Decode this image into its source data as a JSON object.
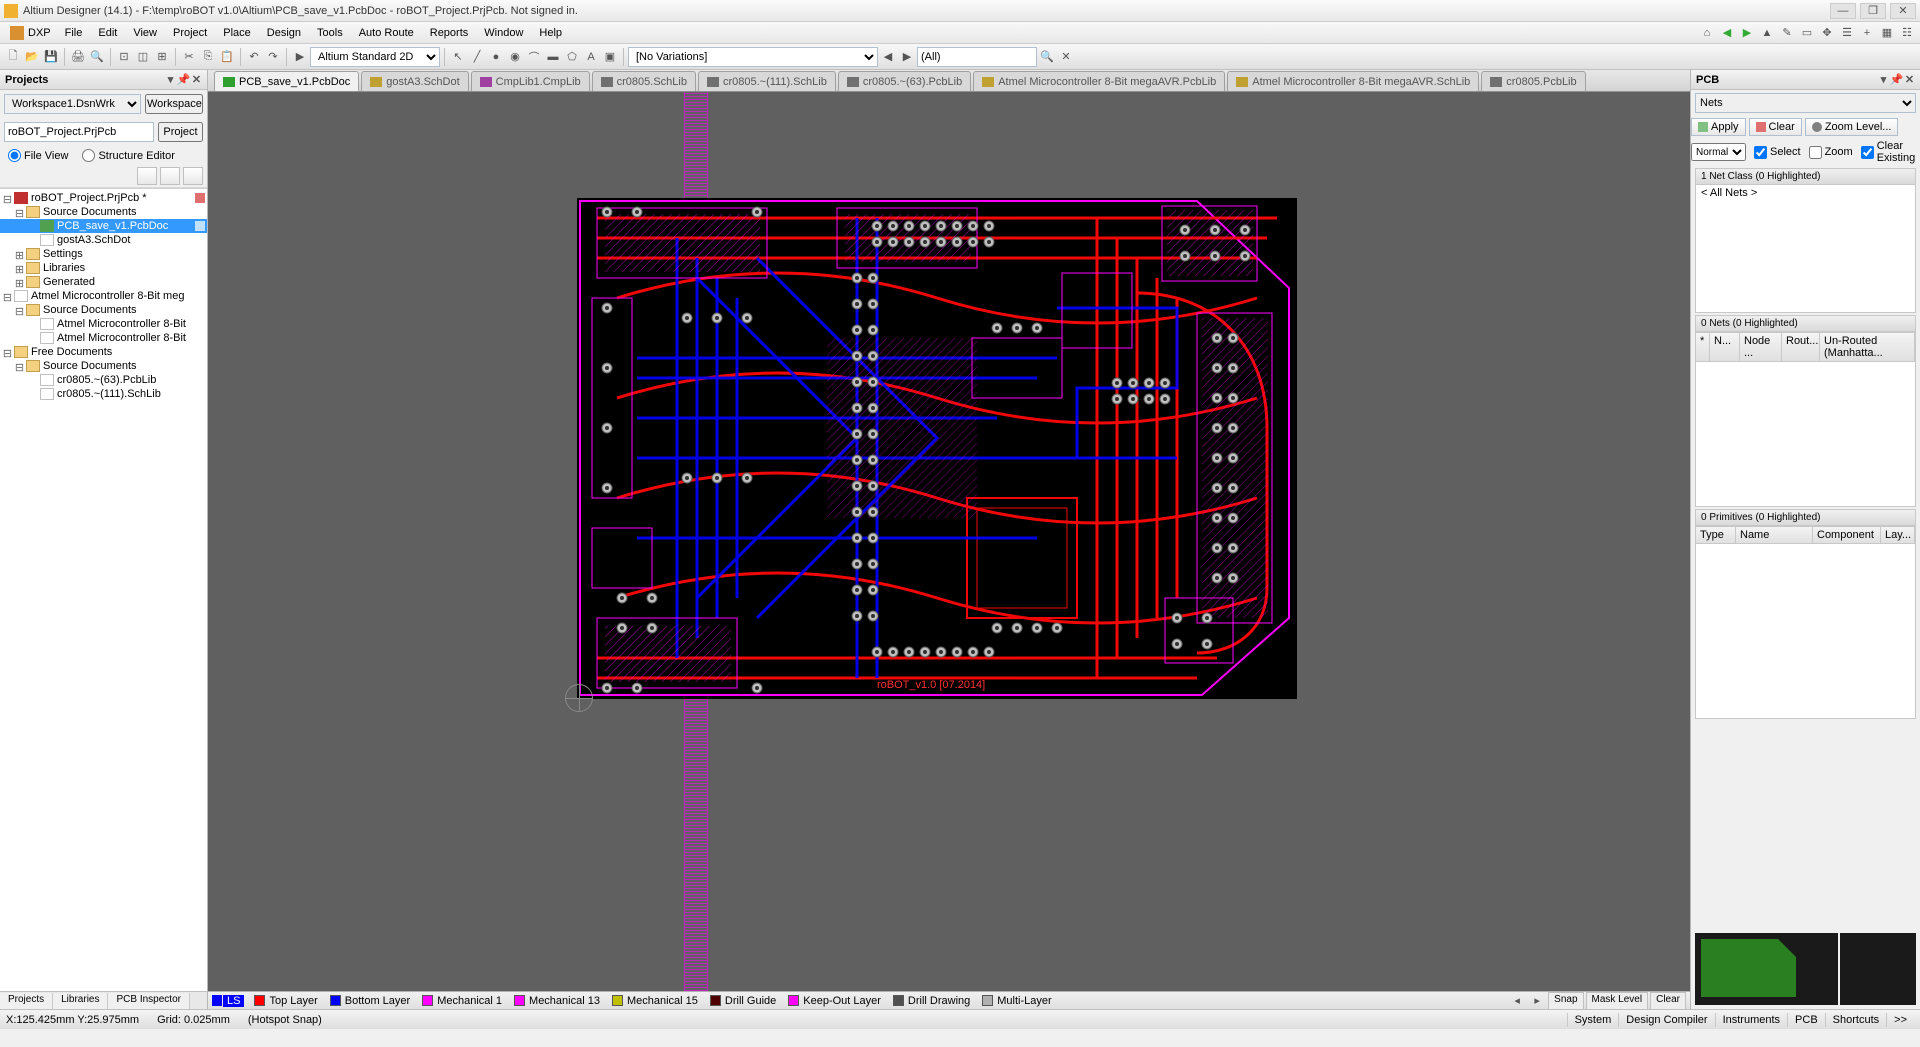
{
  "window": {
    "title": "Altium Designer (14.1) - F:\\temp\\roBOT v1.0\\Altium\\PCB_save_v1.PcbDoc - roBOT_Project.PrjPcb. Not signed in."
  },
  "menu": {
    "dxp": "DXP",
    "items": [
      "File",
      "Edit",
      "View",
      "Project",
      "Place",
      "Design",
      "Tools",
      "Auto Route",
      "Reports",
      "Window",
      "Help"
    ]
  },
  "toolbar": {
    "view_mode": "Altium Standard 2D",
    "variations": "[No Variations]",
    "filter_all": "(All)"
  },
  "left_panel": {
    "title": "Projects",
    "workspace": "Workspace1.DsnWrk",
    "workspace_btn": "Workspace",
    "project": "roBOT_Project.PrjPcb",
    "project_btn": "Project",
    "view_file": "File View",
    "view_struct": "Structure Editor",
    "tree": {
      "n0": "roBOT_Project.PrjPcb *",
      "n1": "Source Documents",
      "n2": "PCB_save_v1.PcbDoc",
      "n3": "gostA3.SchDot",
      "n4": "Settings",
      "n5": "Libraries",
      "n6": "Generated",
      "n7": "Atmel Microcontroller 8-Bit meg",
      "n8": "Source Documents",
      "n9": "Atmel Microcontroller 8-Bit",
      "n10": "Atmel Microcontroller 8-Bit",
      "n11": "Free Documents",
      "n12": "Source Documents",
      "n13": "cr0805.~(63).PcbLib",
      "n14": "cr0805.~(111).SchLib"
    },
    "bottom_tabs": [
      "Projects",
      "Libraries",
      "PCB Inspector"
    ]
  },
  "tabs": [
    {
      "label": "PCB_save_v1.PcbDoc",
      "active": true,
      "color": "#30a030"
    },
    {
      "label": "gostA3.SchDot",
      "active": false,
      "color": "#c0a030"
    },
    {
      "label": "CmpLib1.CmpLib",
      "active": false,
      "color": "#a040a0"
    },
    {
      "label": "cr0805.SchLib",
      "active": false,
      "color": "#707070"
    },
    {
      "label": "cr0805.~(111).SchLib",
      "active": false,
      "color": "#707070"
    },
    {
      "label": "cr0805.~(63).PcbLib",
      "active": false,
      "color": "#707070"
    },
    {
      "label": "Atmel Microcontroller 8-Bit megaAVR.PcbLib",
      "active": false,
      "color": "#c0a030"
    },
    {
      "label": "Atmel Microcontroller 8-Bit megaAVR.SchLib",
      "active": false,
      "color": "#c0a030"
    },
    {
      "label": "cr0805.PcbLib",
      "active": false,
      "color": "#707070"
    }
  ],
  "layers": {
    "ls": "LS",
    "items": [
      {
        "name": "Top Layer",
        "color": "#ff0000"
      },
      {
        "name": "Bottom Layer",
        "color": "#0000ff"
      },
      {
        "name": "Mechanical 1",
        "color": "#ff00ff"
      },
      {
        "name": "Mechanical 13",
        "color": "#ff00ff"
      },
      {
        "name": "Mechanical 15",
        "color": "#c0c000"
      },
      {
        "name": "Drill Guide",
        "color": "#500000"
      },
      {
        "name": "Keep-Out Layer",
        "color": "#ff00ff"
      },
      {
        "name": "Drill Drawing",
        "color": "#505050"
      },
      {
        "name": "Multi-Layer",
        "color": "#b0b0b0"
      }
    ],
    "right": [
      "Snap",
      "Mask Level",
      "Clear"
    ]
  },
  "right_panel": {
    "title": "PCB",
    "selector": "Nets",
    "apply": "Apply",
    "clear": "Clear",
    "zoom": "Zoom Level...",
    "mode": "Normal",
    "ck_select": "Select",
    "ck_zoom": "Zoom",
    "ck_clear_existing": "Clear Existing",
    "sec_netclass": "1 Net Class (0 Highlighted)",
    "all_nets": "< All Nets >",
    "sec_nets": "0 Nets (0 Highlighted)",
    "nets_cols": [
      "*",
      "N...",
      "Node ...",
      "Rout...",
      "Un-Routed (Manhatta..."
    ],
    "sec_prims": "0 Primitives (0 Highlighted)",
    "prims_cols": [
      "Type",
      "Name",
      "Component",
      "Lay..."
    ]
  },
  "pcb_text": "roBOT_v1.0   [07.2014]",
  "status": {
    "coords": "X:125.425mm Y:25.975mm",
    "grid": "Grid: 0.025mm",
    "snap": "(Hotspot Snap)",
    "right": [
      "System",
      "Design Compiler",
      "Instruments",
      "PCB",
      "Shortcuts",
      ">>"
    ]
  }
}
